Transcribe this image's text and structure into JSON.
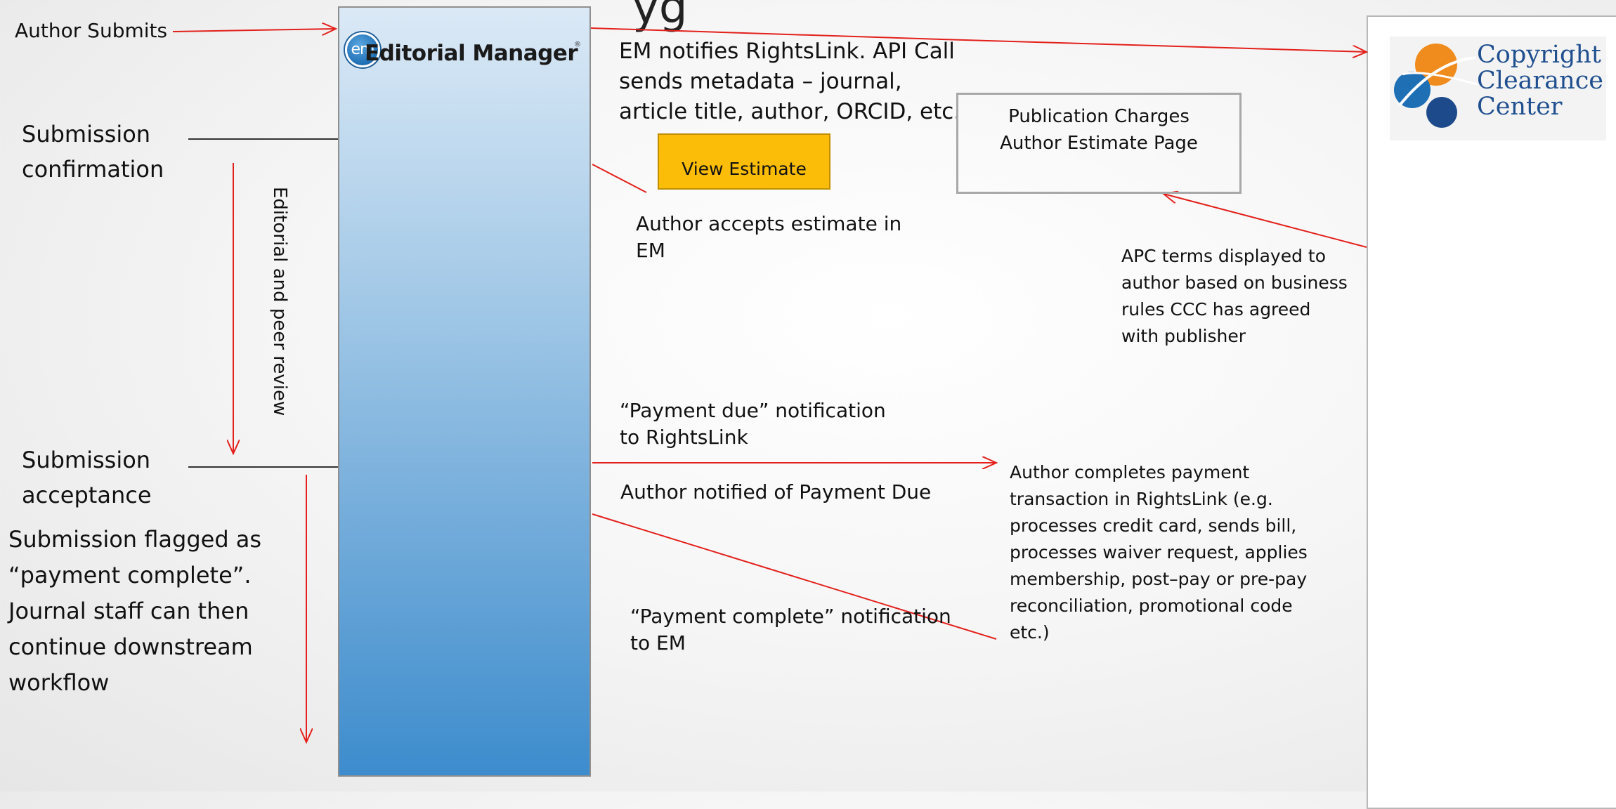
{
  "title_fragment": "...y...g...",
  "em": {
    "logo_badge": "em",
    "logo_name": "Editorial Manager",
    "logo_reg": "®"
  },
  "ccc": {
    "logo_line1": "Copyright",
    "logo_line2": "Clearance",
    "logo_line3": "Center"
  },
  "left": {
    "author_submits": "Author Submits",
    "submission_confirmation": [
      "Submission",
      "confirmation"
    ],
    "editorial_review": "Editorial and peer review",
    "submission_acceptance": [
      "Submission",
      "acceptance"
    ],
    "flagged_text": [
      "Submission flagged as",
      "“payment complete”.",
      "Journal staff can then",
      "continue downstream",
      "workflow"
    ]
  },
  "middle": {
    "em_notifies": [
      "EM notifies RightsLink. API Call",
      "sends metadata – journal,",
      "article title, author, ORCID, etc."
    ],
    "view_estimate_label": "View Estimate",
    "author_accepts": [
      "Author accepts estimate in",
      "EM"
    ],
    "payment_due_notification": [
      "“Payment due” notification",
      "to RightsLink"
    ],
    "author_notified": "Author notified of Payment Due",
    "payment_complete_notification": [
      "“Payment complete” notification",
      "to EM"
    ]
  },
  "right": {
    "pub_charges": [
      "Publication Charges",
      "Author Estimate Page"
    ],
    "apc_terms": [
      "APC terms displayed to",
      "author based on business",
      "rules CCC has agreed",
      "with publisher"
    ],
    "author_completes": [
      "Author completes payment",
      "transaction in RightsLink (e.g.",
      "processes credit card, sends bill,",
      "processes waiver request, applies",
      "membership, post–pay or pre-pay",
      "reconciliation, promotional code",
      "etc.)"
    ]
  },
  "colors": {
    "arrow": "#e3201b",
    "connector": "#333333",
    "button": "#fbbd08",
    "ccc_blue": "#1f4f8f"
  }
}
